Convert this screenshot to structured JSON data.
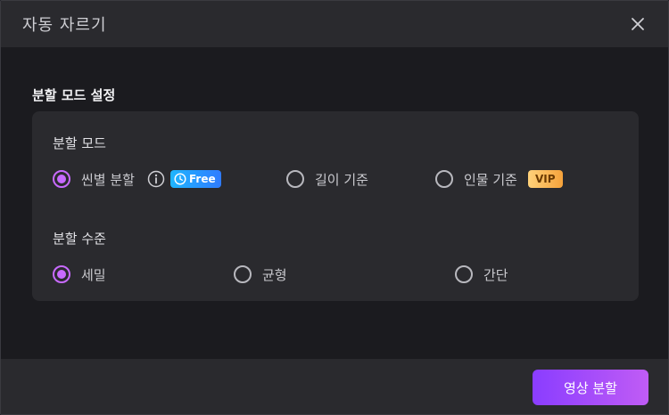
{
  "dialog": {
    "title": "자동 자르기"
  },
  "section": {
    "title": "분할 모드 설정"
  },
  "split_mode": {
    "label": "분할 모드",
    "options": [
      {
        "label": "씬별 분할",
        "selected": true,
        "badge": "Free"
      },
      {
        "label": "길이 기준",
        "selected": false
      },
      {
        "label": "인물 기준",
        "selected": false,
        "badge": "VIP"
      }
    ]
  },
  "split_level": {
    "label": "분할 수준",
    "options": [
      {
        "label": "세밀",
        "selected": true
      },
      {
        "label": "균형",
        "selected": false
      },
      {
        "label": "간단",
        "selected": false
      }
    ]
  },
  "footer": {
    "primary_button": "영상 분할"
  },
  "colors": {
    "accent": "#c86aff",
    "free_badge": "#1fb6ff",
    "vip_badge": "#f5a23b",
    "button_gradient_start": "#8a3dff",
    "button_gradient_end": "#c05cf5"
  },
  "icons": [
    "close-icon",
    "info-icon",
    "clock-icon"
  ]
}
